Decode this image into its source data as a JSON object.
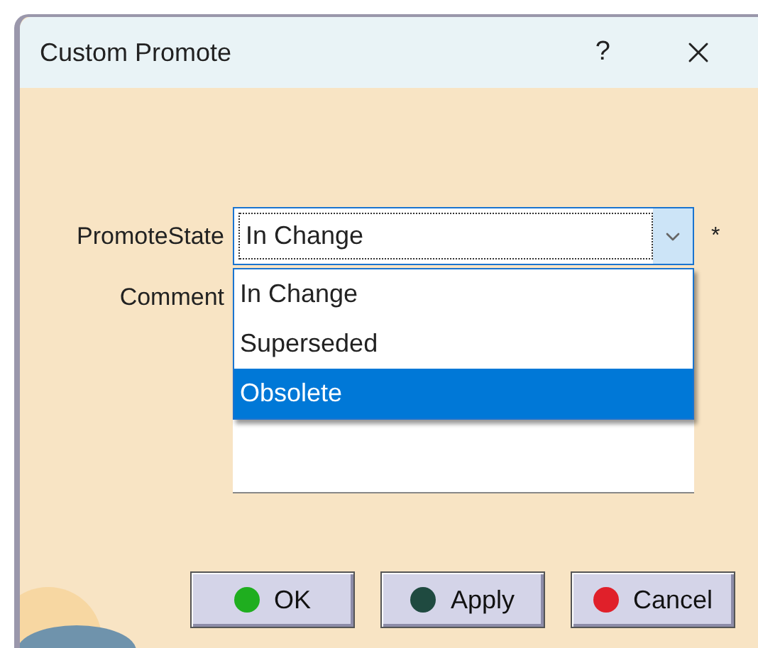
{
  "window": {
    "title": "Custom Promote",
    "help": "?"
  },
  "form": {
    "promote_state": {
      "label": "PromoteState",
      "value": "In Change",
      "required_mark": "*",
      "expanded": true,
      "options": [
        {
          "label": "In Change",
          "highlighted": false
        },
        {
          "label": "Superseded",
          "highlighted": false
        },
        {
          "label": "Obsolete",
          "highlighted": true
        }
      ]
    },
    "comment": {
      "label": "Comment"
    }
  },
  "buttons": [
    {
      "label": "OK",
      "color": "#1fae1f"
    },
    {
      "label": "Apply",
      "color": "#1f4a40"
    },
    {
      "label": "Cancel",
      "color": "#e0202a"
    }
  ]
}
